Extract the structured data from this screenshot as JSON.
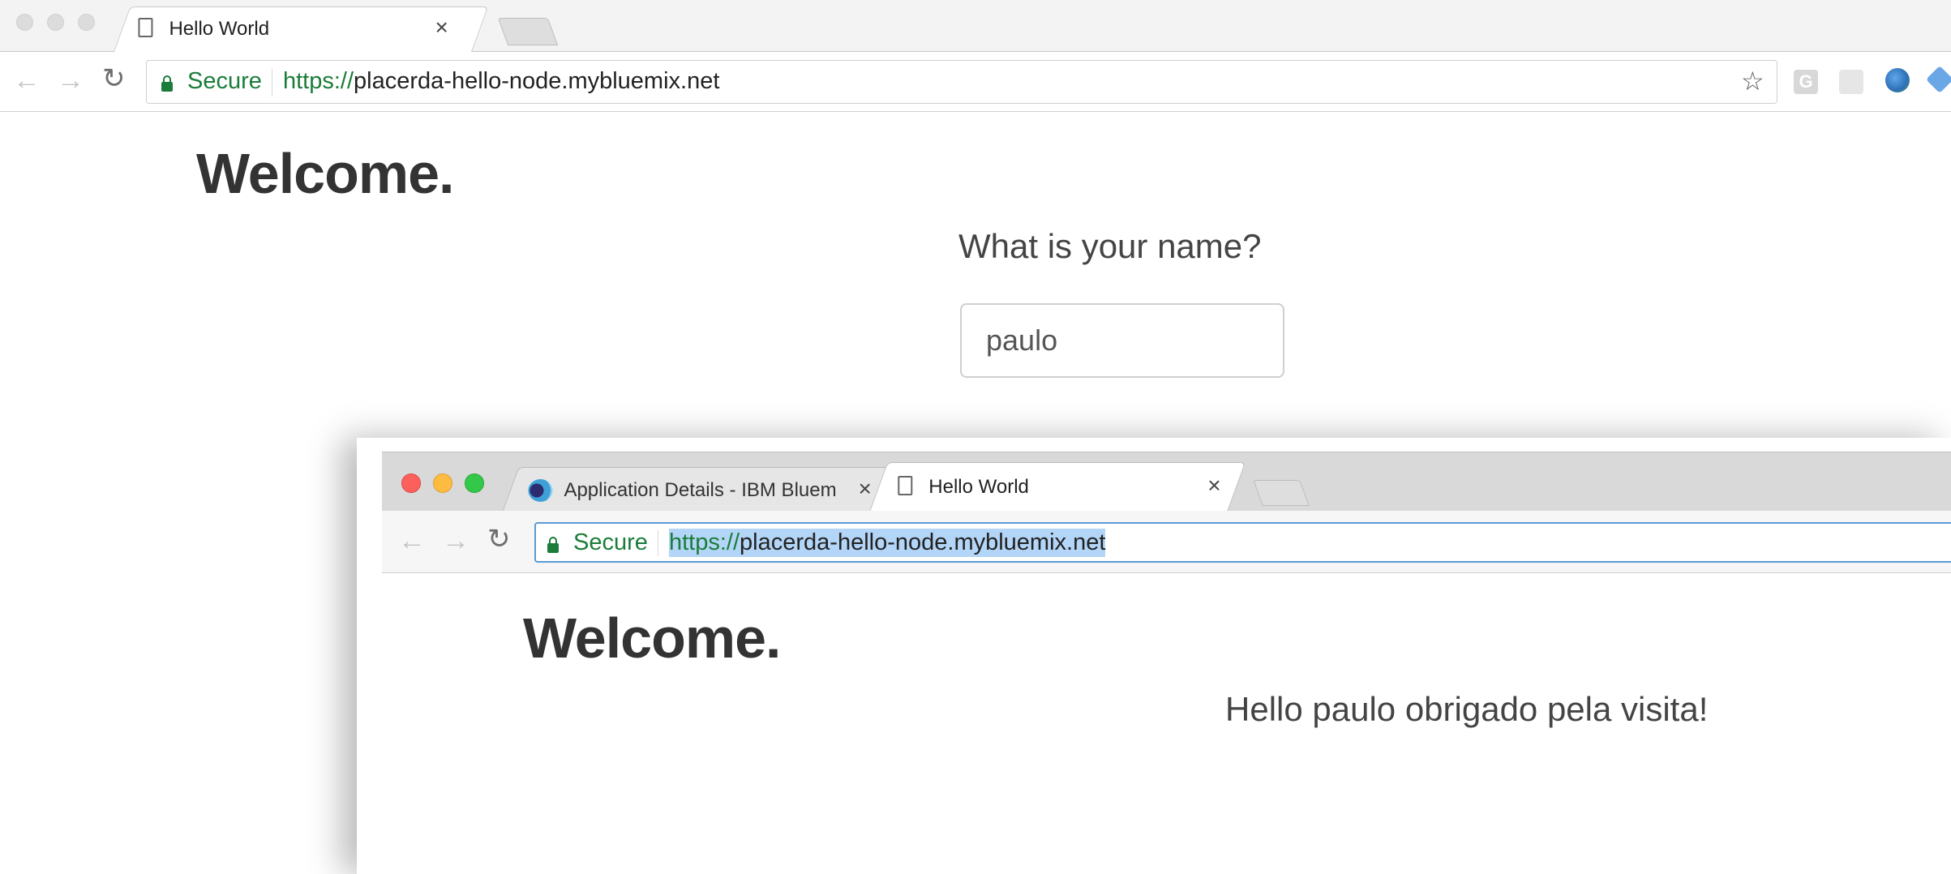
{
  "back_window": {
    "tab": {
      "title": "Hello World",
      "close": "×"
    },
    "omnibox": {
      "secure_label": "Secure",
      "url_protocol": "https://",
      "url_host": "placerda-hello-node.mybluemix.net"
    },
    "extensions": [
      "google-translate-icon",
      "cast-icon",
      "globe-icon",
      "bluemix-icon"
    ],
    "page": {
      "heading": "Welcome.",
      "question": "What is your name?",
      "name_input_value": "paulo"
    }
  },
  "front_window": {
    "tabs": [
      {
        "title": "Application Details - IBM Bluem",
        "close": "×"
      },
      {
        "title": "Hello World",
        "close": "×"
      }
    ],
    "omnibox": {
      "secure_label": "Secure",
      "url_protocol": "https://",
      "url_host": "placerda-hello-node.mybluemix.net"
    },
    "page": {
      "heading": "Welcome.",
      "greeting": "Hello paulo obrigado pela visita!"
    }
  },
  "colors": {
    "secure_green": "#1b7d39",
    "selection_blue": "#b3d5f7",
    "traffic_red": "#fc605c",
    "traffic_yellow": "#fdbc40",
    "traffic_green": "#34c84a"
  }
}
